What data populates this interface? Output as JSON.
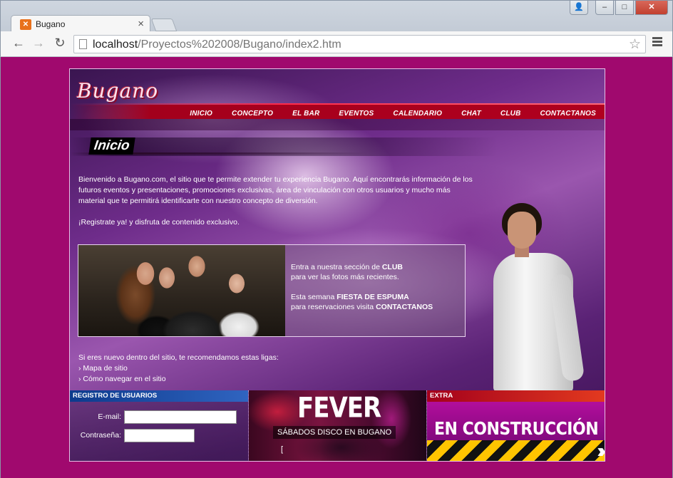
{
  "browser": {
    "tab_title": "Bugano",
    "tab_favicon": "xampp-icon",
    "url_host": "localhost",
    "url_path": "/Proyectos%202008/Bugano/index2.htm"
  },
  "site": {
    "logo": "Bugano",
    "nav": [
      "INICIO",
      "CONCEPTO",
      "EL BAR",
      "EVENTOS",
      "CALENDARIO",
      "CHAT",
      "CLUB",
      "CONTACTANOS"
    ],
    "section_title": "Inicio",
    "intro_paragraph": "Bienvenido a Bugano.com, el sitio que te permite extender tu experiencia Bugano. Aquí encontrarás información de los futuros eventos y presentaciones, promociones exclusivas, área de vinculación con otros usuarios y mucho más material que te permitirá identificarte con nuestro concepto de diversión.",
    "intro_cta": "¡Registrate ya! y disfruta de contenido exclusivo.",
    "club": {
      "line1_pre": "Entra a nuestra sección de ",
      "line1_bold": "CLUB",
      "line2": "para ver las fotos más recientes.",
      "line3_pre": "Esta semana ",
      "line3_bold": "FIESTA DE ESPUMA",
      "line4_pre": "para reservaciones visita ",
      "line4_bold": "CONTACTANOS"
    },
    "links_intro": "Si eres nuevo dentro del sitio, te recomendamos estas ligas:",
    "links": [
      "Mapa de sitio",
      "Cómo navegar en el sitio"
    ],
    "registro": {
      "heading": "REGISTRO DE USUARIOS",
      "email_label": "E-mail:",
      "password_label": "Contraseña:",
      "email_value": "",
      "password_value": ""
    },
    "fever": {
      "title": "FEVER",
      "subtitle": "SÁBADOS DISCO EN BUGANO"
    },
    "extra": {
      "heading": "EXTRA",
      "banner": "EN CONSTRUCCIÓN"
    }
  },
  "colors": {
    "page_background": "#a0096e",
    "nav_band": "#a3001c",
    "registro_header": "#0d3a8c"
  }
}
